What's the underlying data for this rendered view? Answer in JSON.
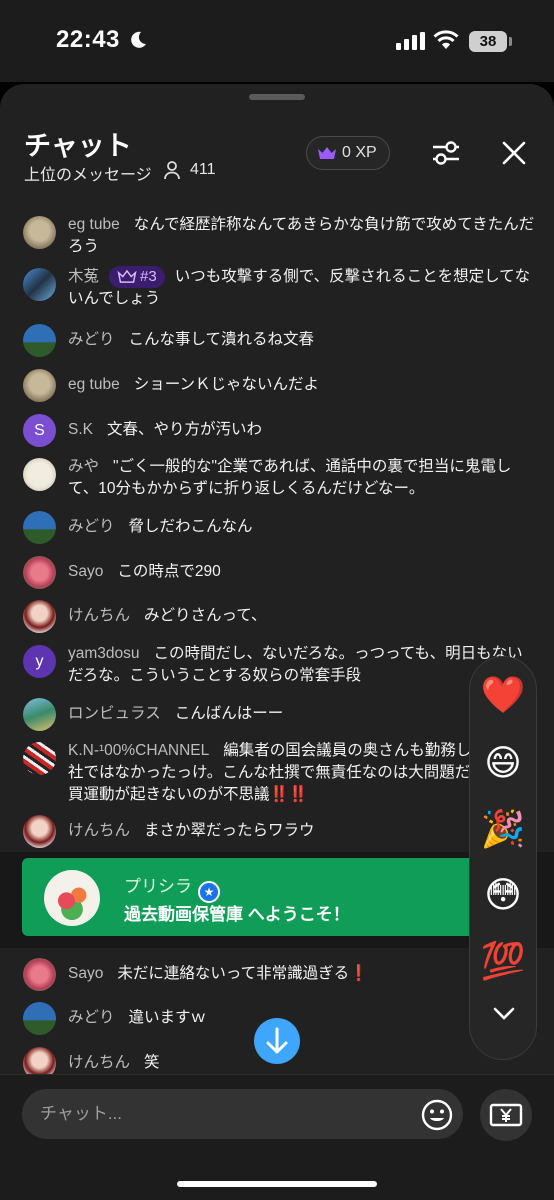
{
  "status_bar": {
    "time": "22:43",
    "battery": "38"
  },
  "header": {
    "title": "チャット",
    "subtitle": "上位のメッセージ",
    "viewer_count": "411",
    "xp_label": "0 XP"
  },
  "messages": [
    {
      "author": "eg tube",
      "text": "なんで経歴詐称なんてあきらかな負け筋で攻めてきたんだろう"
    },
    {
      "author": "木菟",
      "badge": "#3",
      "text": "いつも攻撃する側で、反撃されることを想定してないんでしょう"
    },
    {
      "author": "みどり",
      "text": "こんな事して潰れるね文春"
    },
    {
      "author": "eg tube",
      "text": "ショーンＫじゃないんだよ"
    },
    {
      "author": "S.K",
      "avatar_letter": "S",
      "text": "文春、やり方が汚いわ"
    },
    {
      "author": "みや",
      "text": "\"ごく一般的な\"企業であれば、通話中の裏で担当に鬼電して、10分もかからずに折り返しくるんだけどなー。"
    },
    {
      "author": "みどり",
      "text": "脅しだわこんなん"
    },
    {
      "author": "Sayo",
      "text": "この時点で290"
    },
    {
      "author": "けんちん",
      "text": "みどりさんって、"
    },
    {
      "author": "yam3dosu",
      "avatar_letter": "y",
      "text": "この時間だし、ないだろな。っつっても、明日もないだろな。こういうことする奴らの常套手段"
    },
    {
      "author": "ロンビュラス",
      "text": "こんばんはーー"
    },
    {
      "author": "K.N-¹00%CHANNEL",
      "text": "編集者の国会議員の奥さんも勤務している会社ではなかったっけ。こんな杜撰で無責任なのは大問題だ‼️‼️不買運動が起きないのが不思議‼️‼️"
    },
    {
      "author": "けんちん",
      "text": "まさか翠だったらワラウ"
    },
    {
      "author": "Sayo",
      "text": "未だに連絡ないって非常識過ぎる❗"
    },
    {
      "author": "みどり",
      "text": "違いますｗ"
    },
    {
      "author": "けんちん",
      "text": "笑"
    }
  ],
  "banner": {
    "name": "プリシラ",
    "text": "過去動画保管庫 へようこそ！"
  },
  "reactions": [
    "❤️",
    "😄",
    "🎉",
    "😳",
    "💯"
  ],
  "input": {
    "placeholder": "チャット..."
  },
  "colors": {
    "accent_blue": "#3ea6ff",
    "banner_green": "#0f9d58",
    "badge_purple": "#3b1d6e",
    "background": "#212121"
  }
}
